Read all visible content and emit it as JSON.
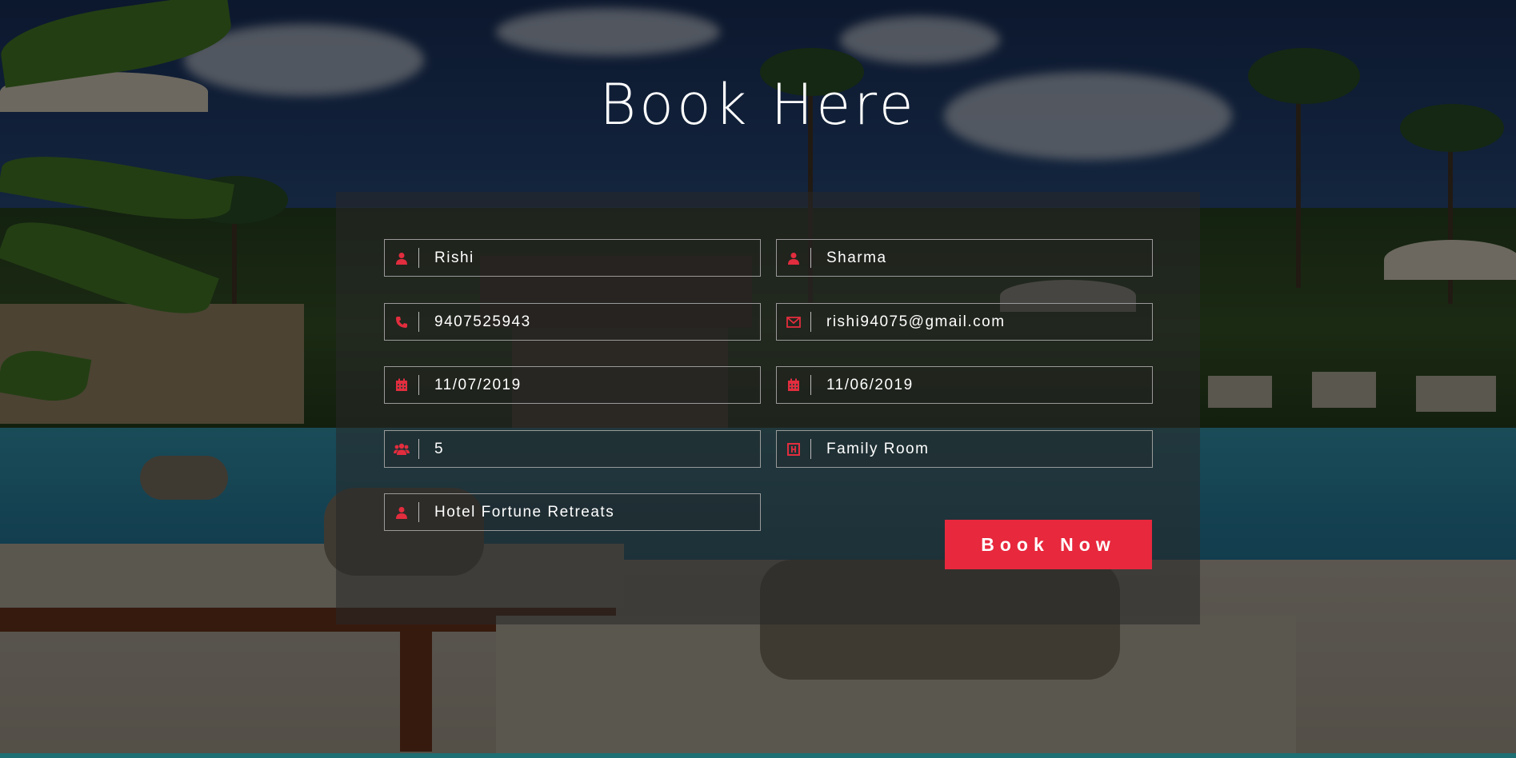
{
  "page": {
    "title": "Book Here"
  },
  "form": {
    "first_name": {
      "value": "Rishi",
      "icon": "user-icon"
    },
    "last_name": {
      "value": "Sharma",
      "icon": "user-icon"
    },
    "phone": {
      "value": "9407525943",
      "icon": "phone-icon"
    },
    "email": {
      "value": "rishi94075@gmail.com",
      "icon": "envelope-icon"
    },
    "check_in": {
      "value": "11/07/2019",
      "icon": "calendar-icon"
    },
    "check_out": {
      "value": "11/06/2019",
      "icon": "calendar-icon"
    },
    "guests": {
      "value": "5",
      "icon": "users-icon"
    },
    "room_type": {
      "value": "Family Room",
      "icon": "hotel-icon"
    },
    "hotel": {
      "value": "Hotel Fortune Retreats",
      "icon": "user-icon"
    },
    "submit_label": "Book Now"
  },
  "colors": {
    "accent": "#e8283d",
    "field_border": "#9a9a9a",
    "text": "#ffffff"
  }
}
